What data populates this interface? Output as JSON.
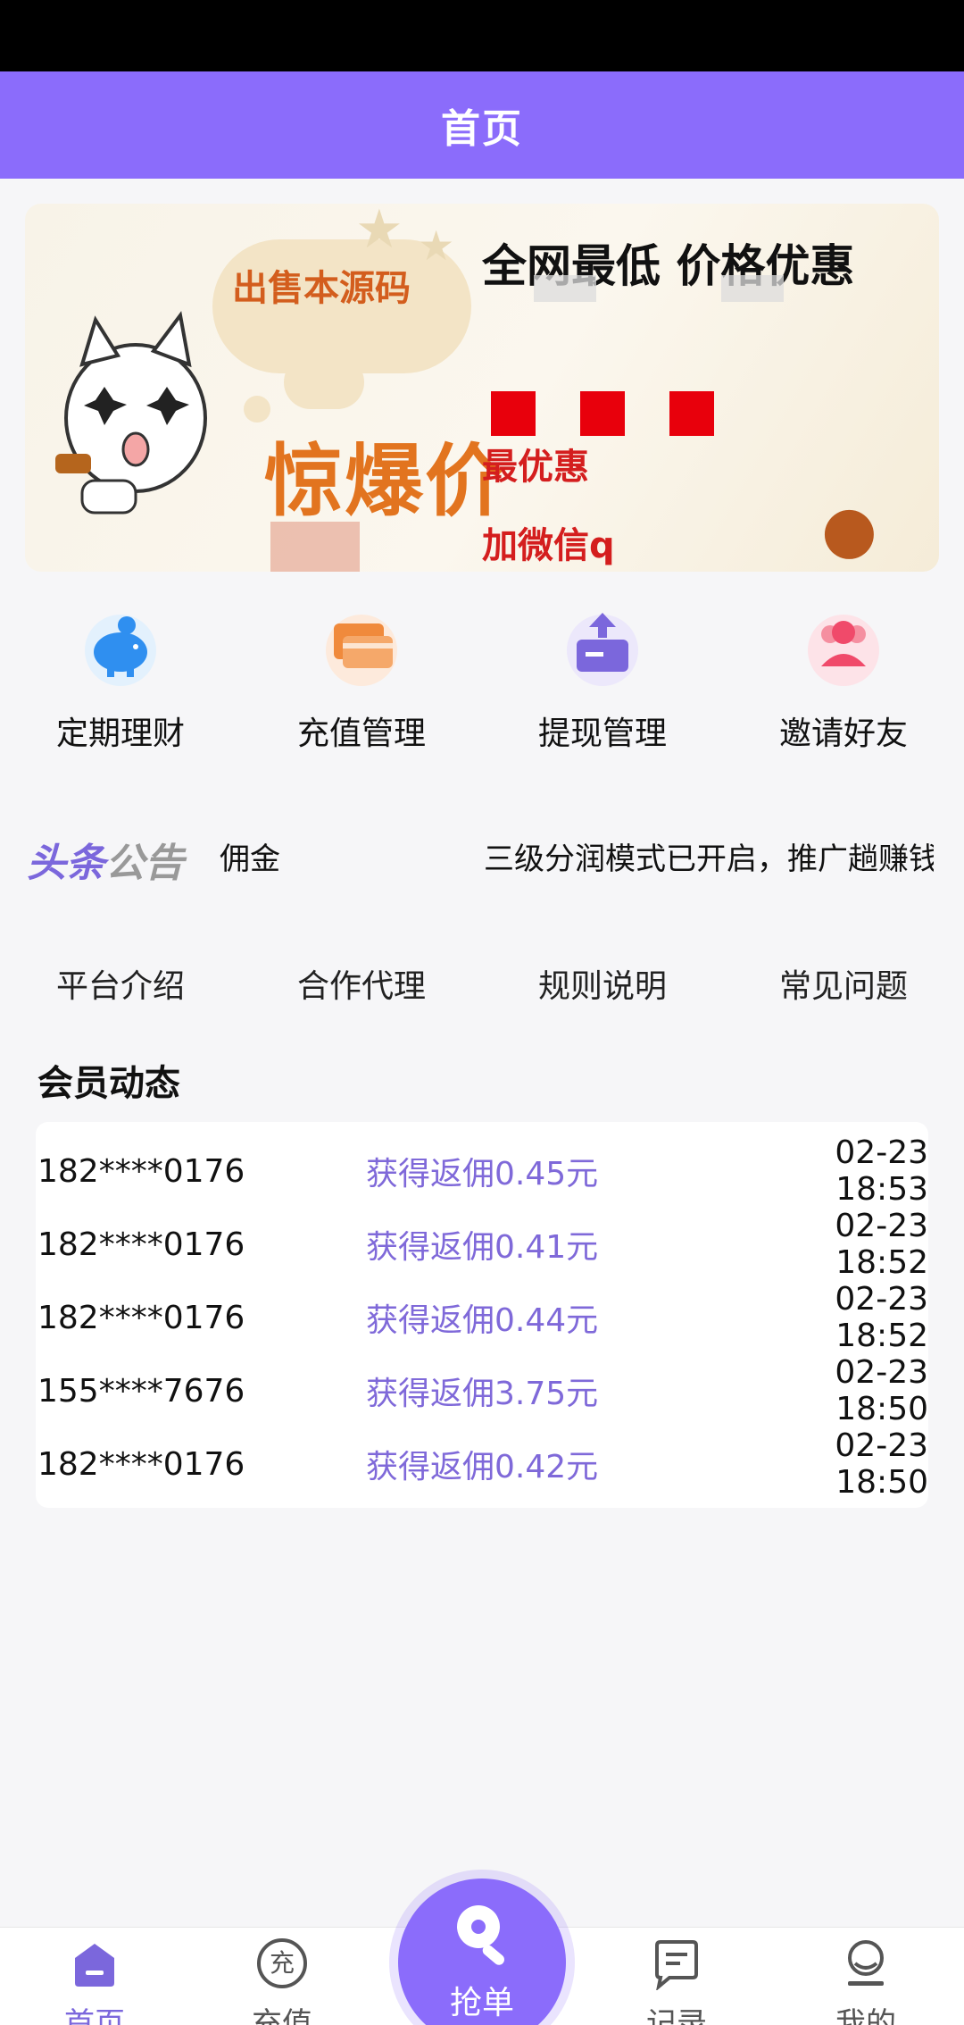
{
  "header": {
    "title": "首页"
  },
  "banner": {
    "sale_text": "出售本源码",
    "big_price": "惊爆价",
    "headline": "全网最低 价格优惠",
    "best": "最优惠",
    "contact": "加微信q"
  },
  "quick_menu": [
    {
      "label": "定期理财",
      "icon": "piggy-bank-icon",
      "color": "#2f8ff0"
    },
    {
      "label": "充值管理",
      "icon": "card-icon",
      "color": "#f08a3c"
    },
    {
      "label": "提现管理",
      "icon": "withdraw-icon",
      "color": "#7b67dc"
    },
    {
      "label": "邀请好友",
      "icon": "friends-icon",
      "color": "#f04a6a"
    }
  ],
  "notice": {
    "tag_main": "头条",
    "tag_sub": "公告",
    "item1": "佣金",
    "item2": "三级分润模式已开启，推广趟赚钱"
  },
  "info_tabs": [
    "平台介绍",
    "合作代理",
    "规则说明",
    "常见问题"
  ],
  "members": {
    "title": "会员动态",
    "rows": [
      {
        "phone": "182****0176",
        "reward": "获得返佣0.45元",
        "time": "02-23 18:53"
      },
      {
        "phone": "182****0176",
        "reward": "获得返佣0.41元",
        "time": "02-23 18:52"
      },
      {
        "phone": "182****0176",
        "reward": "获得返佣0.44元",
        "time": "02-23 18:52"
      },
      {
        "phone": "155****7676",
        "reward": "获得返佣3.75元",
        "time": "02-23 18:50"
      },
      {
        "phone": "182****0176",
        "reward": "获得返佣0.42元",
        "time": "02-23 18:50"
      }
    ]
  },
  "tab_bar": {
    "home": "首页",
    "recharge": "充值",
    "grab": "抢单",
    "records": "记录",
    "mine": "我的",
    "recharge_glyph": "充"
  },
  "colors": {
    "accent": "#8b6cfb",
    "reward_text": "#7f69d9"
  }
}
